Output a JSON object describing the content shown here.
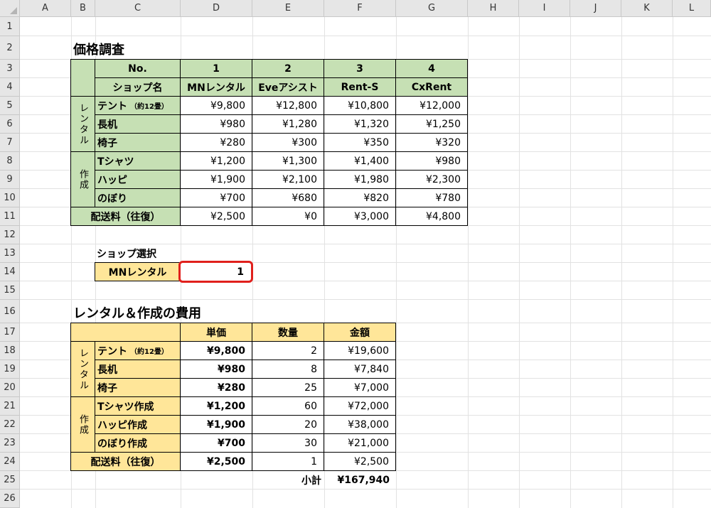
{
  "columns": [
    "A",
    "B",
    "C",
    "D",
    "E",
    "F",
    "G",
    "H",
    "I",
    "J",
    "K",
    "L"
  ],
  "rows": [
    "1",
    "2",
    "3",
    "4",
    "5",
    "6",
    "7",
    "8",
    "9",
    "10",
    "11",
    "12",
    "13",
    "14",
    "15",
    "16",
    "17",
    "18",
    "19",
    "20",
    "21",
    "22",
    "23",
    "24",
    "25",
    "26"
  ],
  "price_table": {
    "title": "価格調査",
    "header_no_label": "No.",
    "header_shop_label": "ショップ名",
    "shop_numbers": [
      "1",
      "2",
      "3",
      "4"
    ],
    "shop_names": [
      "MNレンタル",
      "Eveアシスト",
      "Rent-S",
      "CxRent"
    ],
    "group_rental": "レンタル",
    "group_make": "作成",
    "items": [
      {
        "name": "テント",
        "note": "（約12畳）",
        "values": [
          "¥9,800",
          "¥12,800",
          "¥10,800",
          "¥12,000"
        ]
      },
      {
        "name": "長机",
        "note": "",
        "values": [
          "¥980",
          "¥1,280",
          "¥1,320",
          "¥1,250"
        ]
      },
      {
        "name": "椅子",
        "note": "",
        "values": [
          "¥280",
          "¥300",
          "¥350",
          "¥320"
        ]
      },
      {
        "name": "Tシャツ",
        "note": "",
        "values": [
          "¥1,200",
          "¥1,300",
          "¥1,400",
          "¥980"
        ]
      },
      {
        "name": "ハッピ",
        "note": "",
        "values": [
          "¥1,900",
          "¥2,100",
          "¥1,980",
          "¥2,300"
        ]
      },
      {
        "name": "のぼり",
        "note": "",
        "values": [
          "¥700",
          "¥680",
          "¥820",
          "¥780"
        ]
      }
    ],
    "shipping": {
      "label": "配送料（往復）",
      "values": [
        "¥2,500",
        "¥0",
        "¥3,000",
        "¥4,800"
      ]
    }
  },
  "shop_select": {
    "label": "ショップ選択",
    "shop_name": "MNレンタル",
    "value": "1"
  },
  "cost_table": {
    "title": "レンタル＆作成の費用",
    "headers": [
      "単価",
      "数量",
      "金額"
    ],
    "group_rental": "レンタル",
    "group_make": "作成",
    "items": [
      {
        "name": "テント",
        "note": "（約12畳）",
        "unit": "¥9,800",
        "qty": "2",
        "amount": "¥19,600"
      },
      {
        "name": "長机",
        "note": "",
        "unit": "¥980",
        "qty": "8",
        "amount": "¥7,840"
      },
      {
        "name": "椅子",
        "note": "",
        "unit": "¥280",
        "qty": "25",
        "amount": "¥7,000"
      },
      {
        "name": "Tシャツ作成",
        "note": "",
        "unit": "¥1,200",
        "qty": "60",
        "amount": "¥72,000"
      },
      {
        "name": "ハッピ作成",
        "note": "",
        "unit": "¥1,900",
        "qty": "20",
        "amount": "¥38,000"
      },
      {
        "name": "のぼり作成",
        "note": "",
        "unit": "¥700",
        "qty": "30",
        "amount": "¥21,000"
      }
    ],
    "shipping": {
      "label": "配送料（往復）",
      "unit": "¥2,500",
      "qty": "1",
      "amount": "¥2,500"
    },
    "subtotal_label": "小計",
    "subtotal": "¥167,940"
  }
}
